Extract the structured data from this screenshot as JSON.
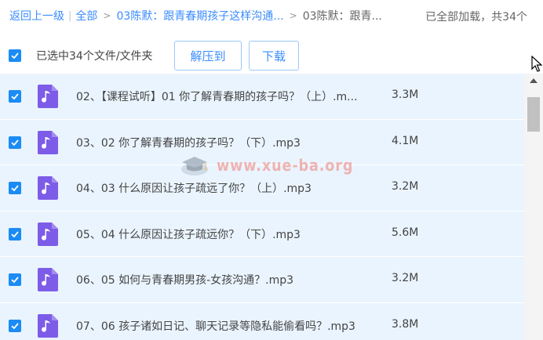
{
  "breadcrumb": {
    "back": "返回上一级",
    "sep": "|",
    "all": "全部",
    "arrow": ">",
    "level1": "03陈默：跟青春期孩子这样沟通...",
    "current": "03陈默：跟青...",
    "status": "已全部加载，共34个"
  },
  "toolbar": {
    "selected_text": "已选中34个文件/文件夹",
    "unzip_label": "解压到",
    "download_label": "下载"
  },
  "files": [
    {
      "name": "02、【课程试听】01 你了解青春期的孩子吗？（上）.m...",
      "size": "3.3M",
      "checked": true
    },
    {
      "name": "03、02 你了解青春期的孩子吗？（下）.mp3",
      "size": "4.1M",
      "checked": true
    },
    {
      "name": "04、03 什么原因让孩子疏远了你？（上）.mp3",
      "size": "3.2M",
      "checked": true
    },
    {
      "name": "05、04 什么原因让孩子疏远你？（下）.mp3",
      "size": "5.6M",
      "checked": true
    },
    {
      "name": "06、05 如何与青春期男孩-女孩沟通？.mp3",
      "size": "3.2M",
      "checked": true
    },
    {
      "name": "07、06 孩子诸如日记、聊天记录等隐私能偷看吗？.mp3",
      "size": "3.8M",
      "checked": true
    }
  ],
  "watermark": "www.xue-ba.org",
  "colors": {
    "accent": "#3b8cff",
    "checkbox": "#1b8bf5",
    "row_bg": "#eaf4fe",
    "file_icon": "#7d5ce8"
  },
  "icons": {
    "checkbox": "check-icon",
    "file": "music-file-icon",
    "watermark_logo": "graduation-cap-icon"
  }
}
